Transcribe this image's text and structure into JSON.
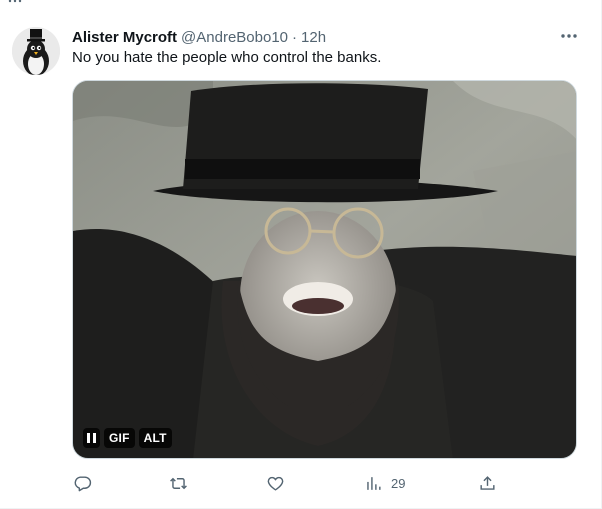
{
  "tweet": {
    "display_name": "Alister Mycroft",
    "handle": "@AndreBobo10",
    "separator": "·",
    "timestamp": "12h",
    "text": "No you hate the people who control the banks."
  },
  "media": {
    "controls": {
      "gif_label": "GIF",
      "alt_label": "ALT"
    }
  },
  "actions": {
    "views_count": "29"
  },
  "icons": {
    "avatar": "penguin-tophat-avatar",
    "more": "more-dots-icon",
    "pause": "pause-icon",
    "reply": "reply-icon",
    "retweet": "retweet-icon",
    "like": "heart-icon",
    "views": "views-bar-chart-icon",
    "share": "share-icon"
  },
  "colors": {
    "text_primary": "#0f1419",
    "text_secondary": "#536471",
    "border": "#cfd9de"
  }
}
